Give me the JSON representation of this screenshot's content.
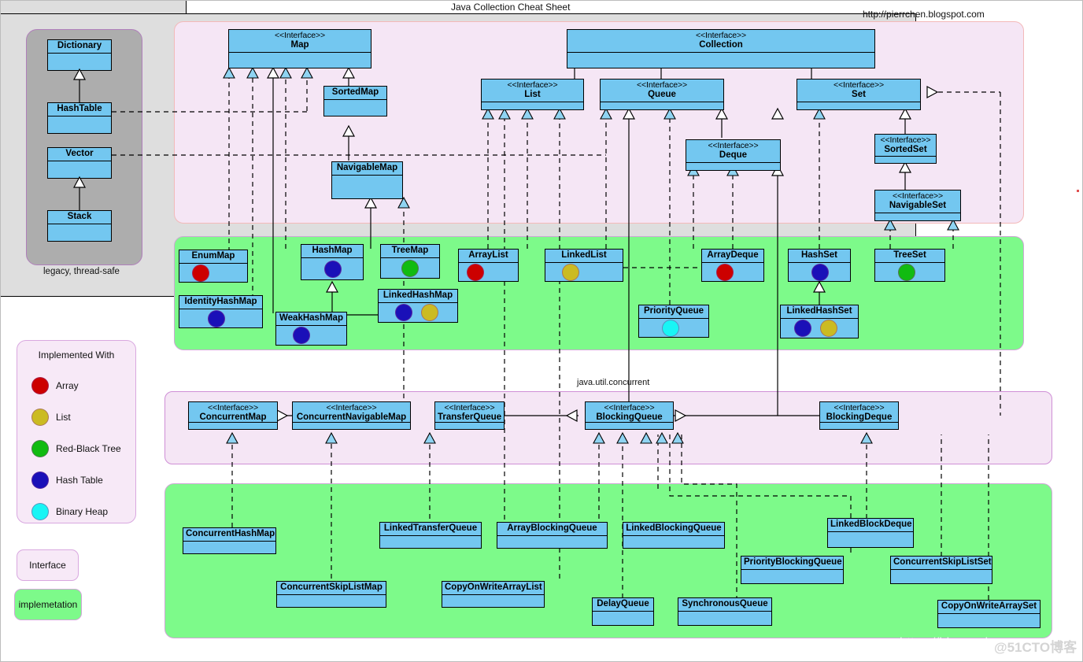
{
  "page": {
    "title": "Java Collection Cheat Sheet",
    "url": "http://pierrchen.blogspot.com",
    "legacy_caption": "legacy, thread-safe",
    "package_label": "java.util.concurrent",
    "watermark_1": "https://blog.csdn.ne",
    "watermark_2": "@51CTO博客"
  },
  "legend": {
    "title": "Implemented With",
    "items": [
      {
        "label": "Array",
        "color": "#cc0000"
      },
      {
        "label": "List",
        "color": "#cbbb22"
      },
      {
        "label": "Red-Black Tree",
        "color": "#11bb11"
      },
      {
        "label": "Hash Table",
        "color": "#1a10b8"
      },
      {
        "label": "Binary Heap",
        "color": "#19f5f5"
      }
    ],
    "key_interface": "Interface",
    "key_implementation": "implemetation"
  },
  "stereotype": "<<Interface>>",
  "legacy": {
    "classes": [
      {
        "name": "Dictionary"
      },
      {
        "name": "HashTable"
      },
      {
        "name": "Vector"
      },
      {
        "name": "Stack"
      }
    ]
  },
  "interfaces_top": [
    {
      "name": "Map",
      "stereo": true
    },
    {
      "name": "Collection",
      "stereo": true
    },
    {
      "name": "SortedMap",
      "stereo": false
    },
    {
      "name": "List",
      "stereo": true
    },
    {
      "name": "Queue",
      "stereo": true
    },
    {
      "name": "Set",
      "stereo": true
    },
    {
      "name": "Deque",
      "stereo": true
    },
    {
      "name": "SortedSet",
      "stereo": true
    },
    {
      "name": "NavigableMap",
      "stereo": false
    },
    {
      "name": "NavigableSet",
      "stereo": true
    }
  ],
  "implementations": [
    {
      "name": "EnumMap",
      "dots": [
        "#cc0000"
      ]
    },
    {
      "name": "IdentityHashMap",
      "dots": [
        "#1a10b8"
      ]
    },
    {
      "name": "HashMap",
      "dots": [
        "#1a10b8"
      ]
    },
    {
      "name": "WeakHashMap",
      "dots": [
        "#1a10b8"
      ]
    },
    {
      "name": "LinkedHashMap",
      "dots": [
        "#1a10b8",
        "#cbbb22"
      ]
    },
    {
      "name": "TreeMap",
      "dots": [
        "#11bb11"
      ]
    },
    {
      "name": "ArrayList",
      "dots": [
        "#cc0000"
      ]
    },
    {
      "name": "LinkedList",
      "dots": [
        "#cbbb22"
      ]
    },
    {
      "name": "PriorityQueue",
      "dots": [
        "#19f5f5"
      ]
    },
    {
      "name": "ArrayDeque",
      "dots": [
        "#cc0000"
      ]
    },
    {
      "name": "HashSet",
      "dots": [
        "#1a10b8"
      ]
    },
    {
      "name": "LinkedHashSet",
      "dots": [
        "#1a10b8",
        "#cbbb22"
      ]
    },
    {
      "name": "TreeSet",
      "dots": [
        "#11bb11"
      ]
    }
  ],
  "concurrent_interfaces": [
    {
      "name": "ConcurrentMap"
    },
    {
      "name": "ConcurrentNavigableMap"
    },
    {
      "name": "TransferQueue"
    },
    {
      "name": "BlockingQueue"
    },
    {
      "name": "BlockingDeque"
    }
  ],
  "concurrent_implementations": [
    {
      "name": "ConcurrentHashMap"
    },
    {
      "name": "ConcurrentSkipListMap"
    },
    {
      "name": "LinkedTransferQueue"
    },
    {
      "name": "CopyOnWriteArrayList"
    },
    {
      "name": "ArrayBlockingQueue"
    },
    {
      "name": "DelayQueue"
    },
    {
      "name": "LinkedBlockingQueue"
    },
    {
      "name": "SynchronousQueue"
    },
    {
      "name": "PriorityBlockingQueue"
    },
    {
      "name": "LinkedBlockDeque"
    },
    {
      "name": "ConcurrentSkipListSet"
    },
    {
      "name": "CopyOnWriteArraySet"
    }
  ]
}
